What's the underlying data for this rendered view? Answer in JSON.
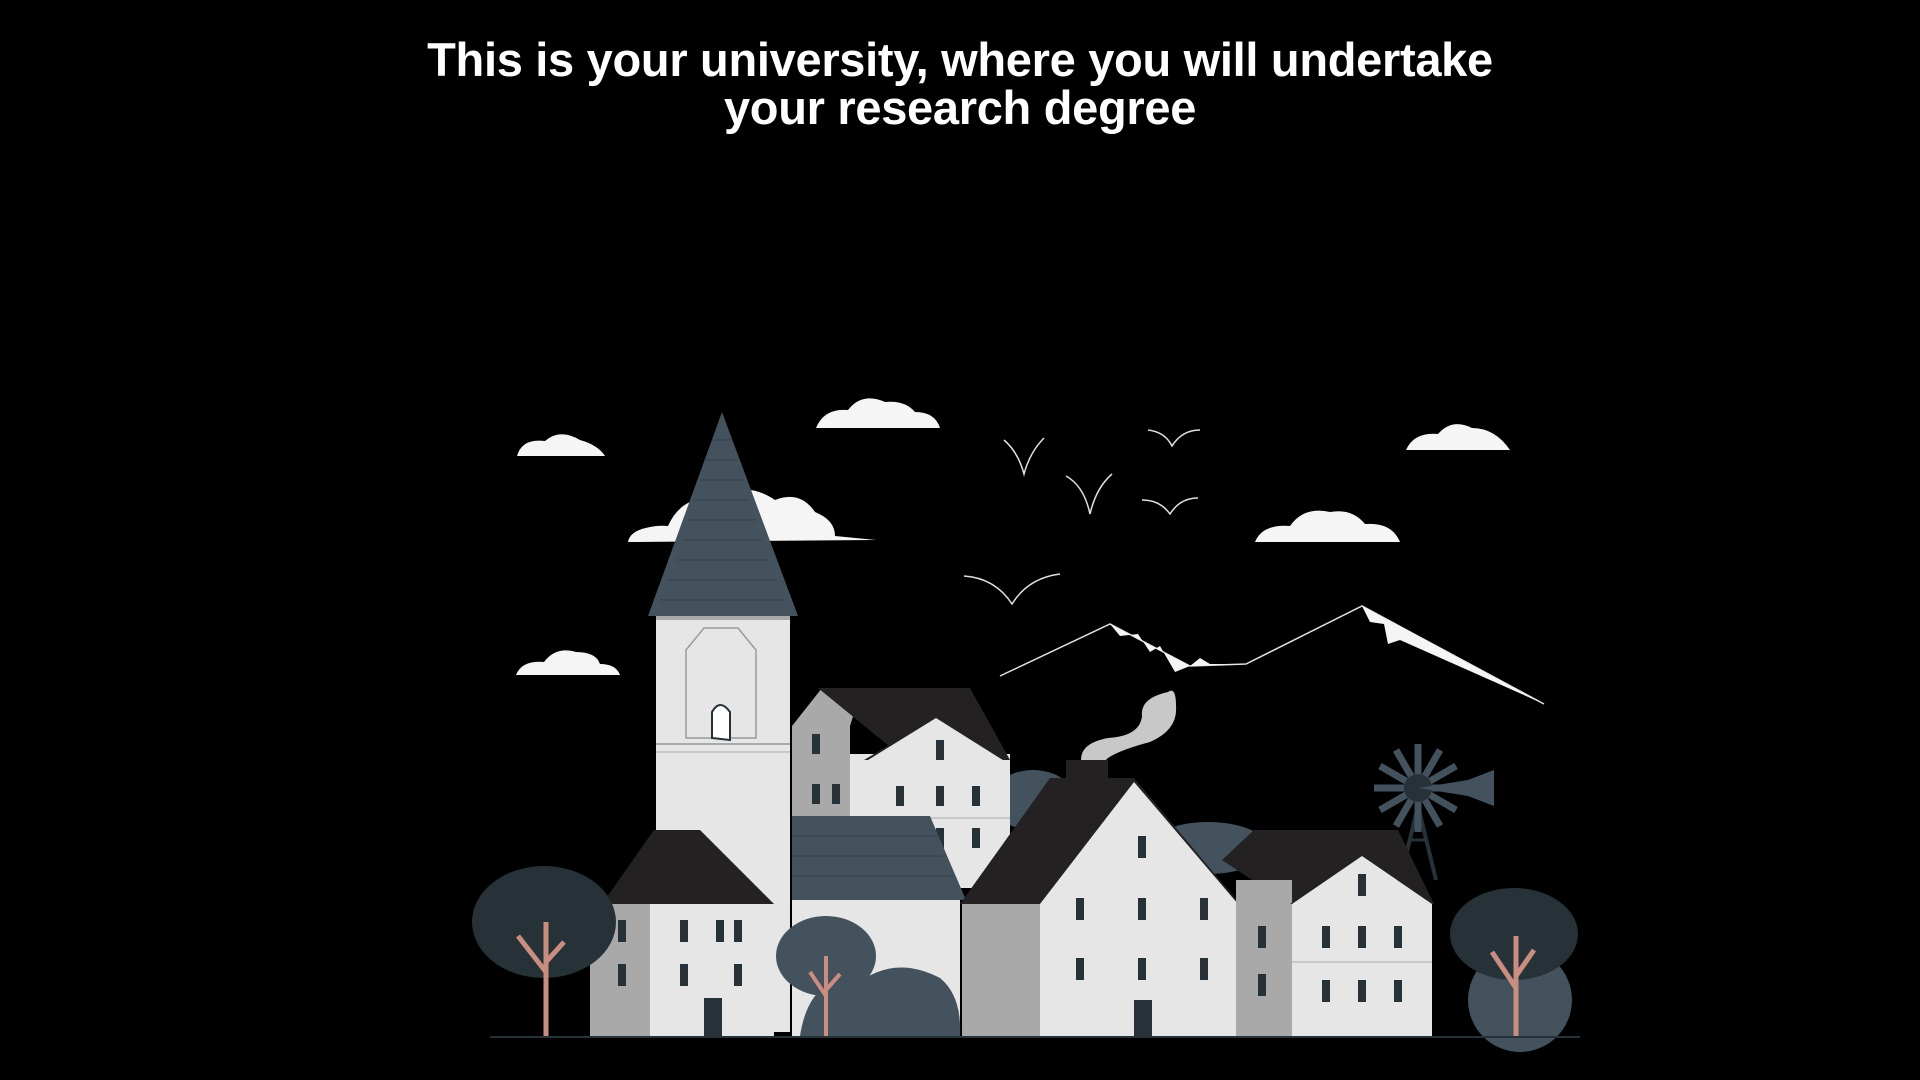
{
  "slide": {
    "title_line1": "This is your university, where you will undertake",
    "title_line2": "your research degree"
  },
  "illustration": {
    "subject": "village-university-scene",
    "colors": {
      "background": "#000000",
      "wall_light": "#e6e6e6",
      "wall_shade": "#a9a9a9",
      "roof_dark": "#232122",
      "roof_slate": "#44525e",
      "tree_foliage": "#263238",
      "tree_trunk": "#c98e7f",
      "cloud": "#f5f5f5",
      "window": "#263238"
    }
  }
}
